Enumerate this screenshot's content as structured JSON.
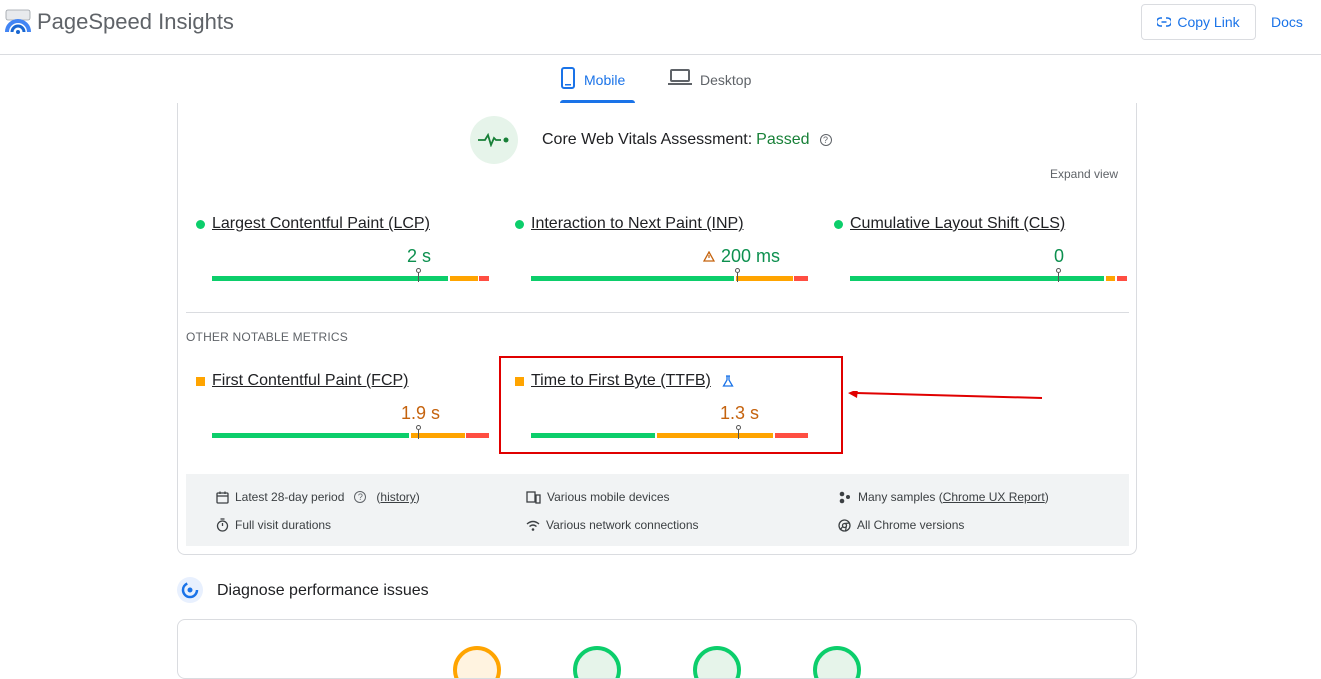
{
  "header": {
    "title": "PageSpeed Insights",
    "copy_link": "Copy Link",
    "docs": "Docs"
  },
  "tabs": [
    {
      "label": "Mobile",
      "icon": "phone-icon",
      "active": true
    },
    {
      "label": "Desktop",
      "icon": "laptop-icon",
      "active": false
    }
  ],
  "assessment": {
    "label": "Core Web Vitals Assessment:",
    "status": "Passed",
    "expand": "Expand view"
  },
  "core_metrics": [
    {
      "label": "Largest Contentful Paint (LCP)",
      "value": "2 s",
      "rating": "good",
      "warning": false
    },
    {
      "label": "Interaction to Next Paint (INP)",
      "value": "200 ms",
      "rating": "good",
      "warning": true
    },
    {
      "label": "Cumulative Layout Shift (CLS)",
      "value": "0",
      "rating": "good",
      "warning": false
    }
  ],
  "other_title": "OTHER NOTABLE METRICS",
  "other_metrics": [
    {
      "label": "First Contentful Paint (FCP)",
      "value": "1.9 s",
      "rating": "needs-improvement"
    },
    {
      "label": "Time to First Byte (TTFB)",
      "value": "1.3 s",
      "rating": "needs-improvement",
      "experimental": true
    }
  ],
  "footer": {
    "period": "Latest 28-day period",
    "history": "history",
    "devices": "Various mobile devices",
    "samples_prefix": "Many samples (",
    "samples_link": "Chrome UX Report",
    "samples_suffix": ")",
    "durations": "Full visit durations",
    "network": "Various network connections",
    "chrome": "All Chrome versions"
  },
  "diagnose": {
    "title": "Diagnose performance issues"
  },
  "colors": {
    "good": "#0cce6b",
    "average": "#ffa400",
    "poor": "#ff4e42",
    "accent": "#1a73e8"
  }
}
